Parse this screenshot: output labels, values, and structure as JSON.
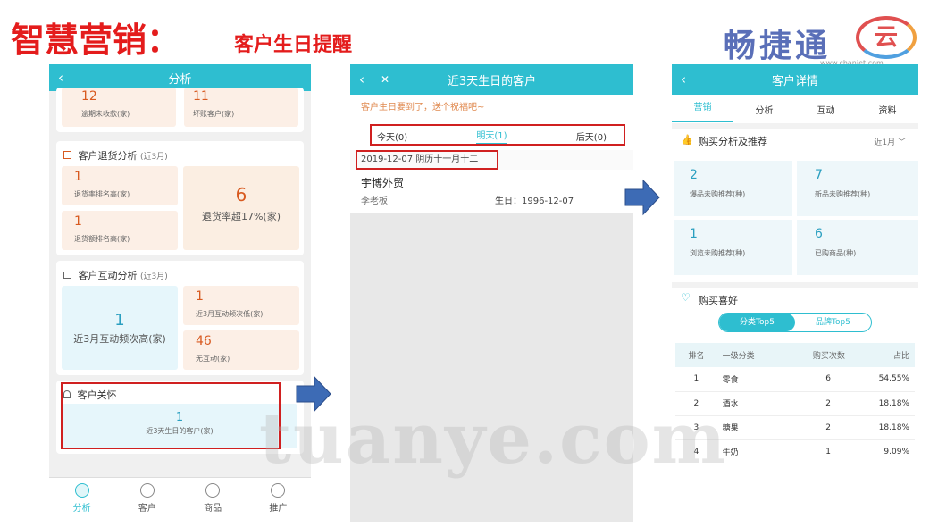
{
  "header": {
    "title": "智慧营销：",
    "subtitle": "客户生日提醒",
    "logo": "畅捷通",
    "logo_mark": "云",
    "logo_url": "www.chanjet.com"
  },
  "screen1": {
    "title": "分析",
    "back": "‹",
    "overdue": {
      "value": "12",
      "label": "逾期未收款(家)"
    },
    "bad": {
      "value": "11",
      "label": "坏账客户(家)"
    },
    "returns": {
      "title": "客户退货分析",
      "period": "(近3月)",
      "a_value": "1",
      "a_label": "退货率排名高(家)",
      "b_value": "1",
      "b_label": "退货额排名高(家)",
      "c_value": "6",
      "c_label": "退货率超17%(家)"
    },
    "interact": {
      "title": "客户互动分析",
      "period": "(近3月)",
      "main_value": "1",
      "main_label": "近3月互动频次高(家)",
      "low_value": "1",
      "low_label": "近3月互动频次低(家)",
      "none_value": "46",
      "none_label": "无互动(家)"
    },
    "care": {
      "title": "客户关怀",
      "value": "1",
      "label": "近3天生日的客户(家)"
    },
    "nav": [
      "分析",
      "客户",
      "商品",
      "推广"
    ]
  },
  "screen2": {
    "title": "近3天生日的客户",
    "back": "‹",
    "close": "✕",
    "notice": "客户生日要到了，送个祝福吧~",
    "tabs": [
      "今天(0)",
      "明天(1)",
      "后天(0)"
    ],
    "date": "2019-12-07 阴历十一月十二",
    "customer": {
      "name": "宇博外贸",
      "contact": "李老板",
      "birthday": "生日：1996-12-07"
    }
  },
  "screen3": {
    "title": "客户详情",
    "back": "‹",
    "tabs": [
      "营销",
      "分析",
      "互动",
      "资料"
    ],
    "rec": {
      "title": "购买分析及推荐",
      "period": "近1月 ﹀"
    },
    "tiles": [
      {
        "value": "2",
        "label": "爆品未购推荐(种)"
      },
      {
        "value": "7",
        "label": "新品未购推荐(种)"
      },
      {
        "value": "1",
        "label": "浏览未购推荐(种)"
      },
      {
        "value": "6",
        "label": "已购商品(种)"
      }
    ],
    "pref": {
      "title": "购买喜好",
      "toggle": [
        "分类Top5",
        "品牌Top5"
      ]
    },
    "table": {
      "headers": [
        "排名",
        "一级分类",
        "购买次数",
        "占比"
      ],
      "rows": [
        [
          "1",
          "零食",
          "6",
          "54.55%"
        ],
        [
          "2",
          "酒水",
          "2",
          "18.18%"
        ],
        [
          "3",
          "糖果",
          "2",
          "18.18%"
        ],
        [
          "4",
          "牛奶",
          "1",
          "9.09%"
        ]
      ]
    }
  },
  "watermark": "tuanye.com",
  "colors": {
    "accent": "#2ebed0",
    "red": "#d02020",
    "arrow": "#3d6bb5"
  }
}
